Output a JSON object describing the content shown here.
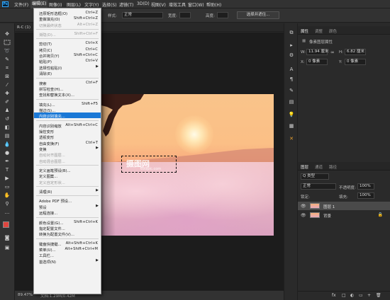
{
  "menubar": {
    "logo": "Ps",
    "items": [
      "文件(F)",
      "编辑(E)",
      "图像(I)",
      "图层(L)",
      "文字(Y)",
      "选择(S)",
      "滤镜(T)",
      "3D(D)",
      "视图(V)",
      "增效工具",
      "窗口(W)",
      "帮助(H)"
    ],
    "active_index": 1
  },
  "options_bar": {
    "style_label": "样式:",
    "style_value": "正常",
    "width_label": "宽度:",
    "height_label": "高度:",
    "select_mask_button": "选择并遮住..."
  },
  "document_tab": {
    "title": "R-C (1)"
  },
  "edit_menu": {
    "items": [
      {
        "label": "还原矩形选框(O)",
        "shortcut": "Ctrl+Z"
      },
      {
        "label": "重做填充(O)",
        "shortcut": "Shift+Ctrl+Z"
      },
      {
        "label": "切换最终状态",
        "shortcut": "Alt+Ctrl+Z",
        "disabled": true
      },
      {
        "sep": true
      },
      {
        "label": "渐隐(D)...",
        "shortcut": "Shift+Ctrl+F",
        "disabled": true
      },
      {
        "sep": true
      },
      {
        "label": "剪切(T)",
        "shortcut": "Ctrl+X"
      },
      {
        "label": "拷贝(C)",
        "shortcut": "Ctrl+C"
      },
      {
        "label": "合并拷贝(Y)",
        "shortcut": "Shift+Ctrl+C"
      },
      {
        "label": "粘贴(P)",
        "shortcut": "Ctrl+V"
      },
      {
        "label": "选择性粘贴(I)",
        "submenu": true
      },
      {
        "label": "清除(E)"
      },
      {
        "sep": true
      },
      {
        "label": "搜索",
        "shortcut": "Ctrl+F"
      },
      {
        "label": "拼写检查(H)..."
      },
      {
        "label": "查找和替换文本(X)..."
      },
      {
        "sep": true
      },
      {
        "label": "填充(L)...",
        "shortcut": "Shift+F5"
      },
      {
        "label": "描边(S)..."
      },
      {
        "label": "内容识别填充...",
        "highlighted": true
      },
      {
        "sep": true
      },
      {
        "label": "内容识别缩放",
        "shortcut": "Alt+Shift+Ctrl+C"
      },
      {
        "label": "操控变形"
      },
      {
        "label": "透视变形"
      },
      {
        "label": "自由变换(F)",
        "shortcut": "Ctrl+T"
      },
      {
        "label": "变换",
        "submenu": true
      },
      {
        "label": "自动对齐图层...",
        "disabled": true
      },
      {
        "label": "自动混合图层...",
        "disabled": true
      },
      {
        "sep": true
      },
      {
        "label": "定义画笔预设(B)..."
      },
      {
        "label": "定义图案..."
      },
      {
        "label": "定义自定形状...",
        "disabled": true
      },
      {
        "sep": true
      },
      {
        "label": "清理(R)",
        "submenu": true
      },
      {
        "sep": true
      },
      {
        "label": "Adobe PDF 预设..."
      },
      {
        "label": "预设",
        "submenu": true
      },
      {
        "label": "远程连接..."
      },
      {
        "sep": true
      },
      {
        "label": "颜色设置(G)...",
        "shortcut": "Shift+Ctrl+K"
      },
      {
        "label": "指定配置文件..."
      },
      {
        "label": "转换为配置文件(V)..."
      },
      {
        "sep": true
      },
      {
        "label": "键盘快捷键...",
        "shortcut": "Alt+Shift+Ctrl+K"
      },
      {
        "label": "菜单(U)...",
        "shortcut": "Alt+Shift+Ctrl+M"
      },
      {
        "label": "工具栏..."
      },
      {
        "label": "首选项(N)",
        "submenu": true
      }
    ]
  },
  "watermark": {
    "text": "摄图网",
    "sub": "699pic.com"
  },
  "status_bar": {
    "zoom": "89.47%",
    "doc_info": "文档:1.29M/0.42M"
  },
  "properties_panel": {
    "tabs": [
      "属性",
      "调整",
      "颜色"
    ],
    "section_title": "像素图层属性",
    "w_label": "W:",
    "w_value": "11.94 厘米",
    "h_label": "H:",
    "h_value": "6.82 厘米",
    "x_label": "X:",
    "x_value": "0 像素",
    "y_label": "Y:",
    "y_value": "0 像素"
  },
  "layers_panel": {
    "tabs": [
      "图层",
      "通道",
      "路径"
    ],
    "filter_label": "Q 类型",
    "blend_mode": "正常",
    "opacity_label": "不透明度:",
    "opacity_value": "100%",
    "lock_label": "锁定:",
    "fill_label": "填充:",
    "fill_value": "100%",
    "layers": [
      {
        "name": "图层 1",
        "selected": true
      },
      {
        "name": "背景",
        "locked": true
      }
    ],
    "bottom_icons": [
      "fx",
      "□",
      "◐",
      "▭",
      "+",
      "🗑"
    ]
  }
}
